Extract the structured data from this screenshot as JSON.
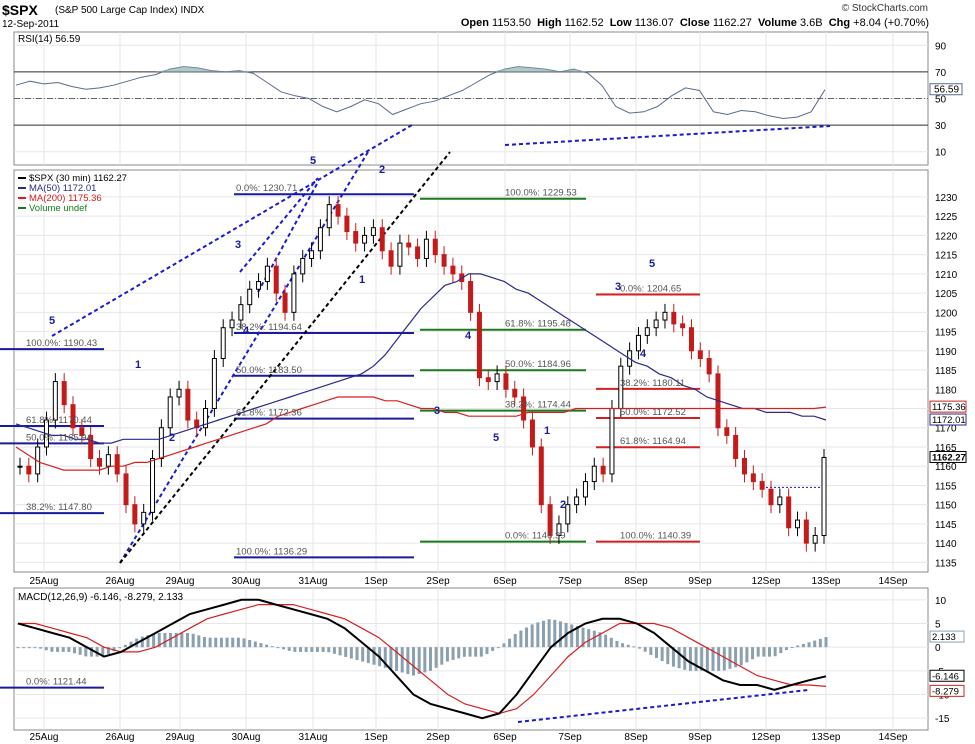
{
  "header": {
    "symbol": "$SPX",
    "description": "(S&P 500 Large Cap Index) INDX",
    "date": "12-Sep-2011",
    "watermark": "© StockCharts.com",
    "open_label": "Open",
    "open": "1153.50",
    "high_label": "High",
    "high": "1162.52",
    "low_label": "Low",
    "low": "1136.07",
    "close_label": "Close",
    "close": "1162.27",
    "volume_label": "Volume",
    "volume": "3.6B",
    "chg_label": "Chg",
    "chg": "+8.04 (+0.70%)"
  },
  "chart_data": [
    {
      "type": "line",
      "panel": "rsi",
      "legend": "RSI(14) 56.59",
      "ylim": [
        0,
        100
      ],
      "ticks": [
        10,
        30,
        50,
        70,
        90
      ],
      "reference_lines": [
        30,
        70
      ],
      "last_value_label": "56.59",
      "series": [
        {
          "name": "RSI(14)",
          "values": [
            60,
            63,
            61,
            62,
            59,
            57,
            58,
            60,
            63,
            66,
            68,
            72,
            74,
            73,
            71,
            70,
            71,
            69,
            62,
            55,
            52,
            50,
            44,
            40,
            44,
            49,
            46,
            38,
            42,
            46,
            48,
            52,
            56,
            62,
            68,
            72,
            74,
            73,
            72,
            70,
            72,
            69,
            60,
            44,
            39,
            40,
            44,
            52,
            58,
            56,
            40,
            38,
            41,
            40,
            37,
            35,
            36,
            40,
            56.59
          ]
        }
      ]
    },
    {
      "type": "candlestick",
      "panel": "price",
      "legend": [
        "$SPX (30 min) 1162.27",
        "MA(50) 1172.01",
        "MA(200) 1175.36",
        "Volume undef"
      ],
      "ylim": [
        1132.5,
        1237
      ],
      "ticks": [
        1135,
        1140,
        1145,
        1150,
        1155,
        1160,
        1165,
        1170,
        1175,
        1180,
        1185,
        1190,
        1195,
        1200,
        1205,
        1210,
        1215,
        1220,
        1225,
        1230
      ],
      "x_ticks": [
        "25Aug",
        "26Aug",
        "29Aug",
        "30Aug",
        "31Aug",
        "1Sep",
        "2Sep",
        "6Sep",
        "7Sep",
        "8Sep",
        "9Sep",
        "12Sep",
        "13Sep",
        "14Sep"
      ],
      "last_labels": [
        "1175.36",
        "1172.01",
        "1162.27"
      ],
      "close_values": [
        1160,
        1158,
        1165,
        1172,
        1182,
        1176,
        1170,
        1168,
        1162,
        1160,
        1163,
        1158,
        1150,
        1145,
        1148,
        1162,
        1170,
        1178,
        1180,
        1172,
        1170,
        1175,
        1188,
        1196,
        1198,
        1202,
        1206,
        1208,
        1212,
        1205,
        1200,
        1210,
        1214,
        1216,
        1222,
        1228,
        1225,
        1221,
        1218,
        1220,
        1222,
        1216,
        1212,
        1218,
        1217,
        1214,
        1219,
        1215,
        1212,
        1210,
        1208,
        1200,
        1183,
        1182,
        1184,
        1180,
        1178,
        1172,
        1165,
        1150,
        1142,
        1145,
        1150,
        1152,
        1156,
        1160,
        1158,
        1175,
        1186,
        1190,
        1194,
        1196,
        1198,
        1200,
        1197,
        1196,
        1190,
        1188,
        1184,
        1170,
        1168,
        1162,
        1158,
        1156,
        1154,
        1150,
        1152,
        1144,
        1146,
        1140,
        1142,
        1162.27
      ],
      "ma50": [
        1171,
        1170,
        1169,
        1168,
        1168,
        1167,
        1167,
        1166,
        1166,
        1167,
        1167,
        1167,
        1167,
        1168,
        1169,
        1170,
        1171,
        1172,
        1173,
        1174,
        1175,
        1176,
        1177,
        1178,
        1179,
        1180,
        1181,
        1182,
        1183,
        1184,
        1186,
        1189,
        1193,
        1197,
        1201,
        1204,
        1207,
        1208,
        1210,
        1210,
        1209,
        1208,
        1206,
        1205,
        1203,
        1201,
        1199,
        1197,
        1195,
        1193,
        1191,
        1189,
        1187,
        1186,
        1184,
        1183,
        1181,
        1180,
        1178,
        1177,
        1176,
        1175,
        1175,
        1174,
        1174,
        1174,
        1173,
        1173,
        1172
      ],
      "ma200": [
        1165,
        1163,
        1161,
        1160,
        1159,
        1159,
        1159,
        1159,
        1160,
        1160,
        1161,
        1161,
        1162,
        1163,
        1164,
        1165,
        1166,
        1167,
        1168,
        1169,
        1170,
        1171,
        1173,
        1174,
        1175,
        1176,
        1177,
        1178,
        1178,
        1178,
        1178,
        1177,
        1177,
        1176,
        1175,
        1175,
        1174,
        1174,
        1173,
        1173,
        1173,
        1173,
        1173,
        1174,
        1174,
        1174,
        1174,
        1175,
        1175,
        1175,
        1175,
        1175,
        1175,
        1175,
        1175,
        1175,
        1175,
        1175,
        1175,
        1175,
        1175,
        1175,
        1175,
        1175,
        1175,
        1175,
        1175,
        1175,
        1175.36
      ],
      "fib_sets": [
        {
          "color": "#1a1aa0",
          "levels": [
            {
              "label": "0.0%: 1230.71",
              "value": 1230.71
            },
            {
              "label": "38.2%: 1194.64",
              "value": 1194.64
            },
            {
              "label": "50.0%: 1183.50",
              "value": 1183.5
            },
            {
              "label": "61.8%: 1172.36",
              "value": 1172.36
            },
            {
              "label": "100.0%: 1136.29",
              "value": 1136.29
            }
          ]
        },
        {
          "color": "#1a1aa0",
          "levels": [
            {
              "label": "100.0%: 1190.43",
              "value": 1190.43
            },
            {
              "label": "61.8%: 1170.44",
              "value": 1170.44
            },
            {
              "label": "50.0%: 1165.94",
              "value": 1165.94
            },
            {
              "label": "38.2%: 1147.80",
              "value": 1147.8
            },
            {
              "label": "0.0%: 1121.44",
              "value": 1121.44
            }
          ]
        },
        {
          "color": "#1b7a1b",
          "levels": [
            {
              "label": "100.0%: 1229.53",
              "value": 1229.53
            },
            {
              "label": "61.8%: 1195.48",
              "value": 1195.48
            },
            {
              "label": "50.0%: 1184.96",
              "value": 1184.96
            },
            {
              "label": "38.2%: 1174.44",
              "value": 1174.44
            },
            {
              "label": "0.0%: 1140.39",
              "value": 1140.39
            }
          ]
        },
        {
          "color": "#d42020",
          "levels": [
            {
              "label": "0.0%: 1204.65",
              "value": 1204.65
            },
            {
              "label": "38.2%: 1180.11",
              "value": 1180.11
            },
            {
              "label": "50.0%: 1172.52",
              "value": 1172.52
            },
            {
              "label": "61.8%: 1164.94",
              "value": 1164.94
            },
            {
              "label": "100.0%: 1140.39",
              "value": 1140.39
            }
          ]
        }
      ],
      "wave_labels": [
        "5",
        "1",
        "2",
        "3",
        "4",
        "5",
        "2",
        "1",
        "3",
        "4",
        "5",
        "1",
        "2",
        "3",
        "4",
        "5"
      ]
    },
    {
      "type": "line",
      "panel": "macd",
      "legend": "MACD(12,26,9) -6.146, -8.279, 2.133",
      "ylim": [
        -17.5,
        12.5
      ],
      "ticks": [
        -15,
        -10,
        -5,
        0,
        5,
        10
      ],
      "last_labels": [
        "2.133",
        "-6.146",
        "-8.279"
      ],
      "series": [
        {
          "name": "MACD(12,26,9)",
          "values": [
            5,
            4,
            3,
            2,
            0,
            -2,
            -1,
            1,
            3,
            5,
            7,
            8,
            9,
            10,
            10,
            9,
            8,
            7,
            6,
            4,
            1,
            -2,
            -6,
            -10,
            -12,
            -13,
            -14,
            -15,
            -14,
            -10,
            -5,
            0,
            3,
            5,
            6,
            6,
            5,
            3,
            0,
            -3,
            -5,
            -7,
            -8,
            -8,
            -9,
            -8,
            -7,
            -6.146
          ]
        },
        {
          "name": "Signal",
          "values": [
            5,
            5,
            4,
            3,
            2,
            0,
            -1,
            -1,
            0,
            2,
            4,
            6,
            7,
            8,
            9,
            9,
            9,
            8,
            7,
            6,
            4,
            2,
            -1,
            -4,
            -7,
            -10,
            -12,
            -13,
            -14,
            -13,
            -10,
            -6,
            -2,
            1,
            3,
            5,
            5,
            5,
            4,
            2,
            0,
            -2,
            -4,
            -6,
            -7,
            -8,
            -8,
            -8.279
          ]
        },
        {
          "name": "Histogram",
          "values": [
            0,
            0,
            -1,
            -1,
            -2,
            -2,
            0,
            2,
            3,
            3,
            3,
            2,
            2,
            2,
            1,
            0,
            -1,
            -1,
            -1,
            -2,
            -3,
            -4,
            -5,
            -6,
            -5,
            -3,
            -2,
            -2,
            0,
            3,
            5,
            6,
            5,
            4,
            3,
            1,
            0,
            -2,
            -4,
            -5,
            -5,
            -5,
            -4,
            -2,
            -2,
            0,
            1,
            2.133
          ]
        }
      ],
      "x_ticks": [
        "25Aug",
        "26Aug",
        "29Aug",
        "30Aug",
        "31Aug",
        "1Sep",
        "2Sep",
        "6Sep",
        "7Sep",
        "8Sep",
        "9Sep",
        "12Sep",
        "13Sep",
        "14Sep"
      ]
    }
  ]
}
